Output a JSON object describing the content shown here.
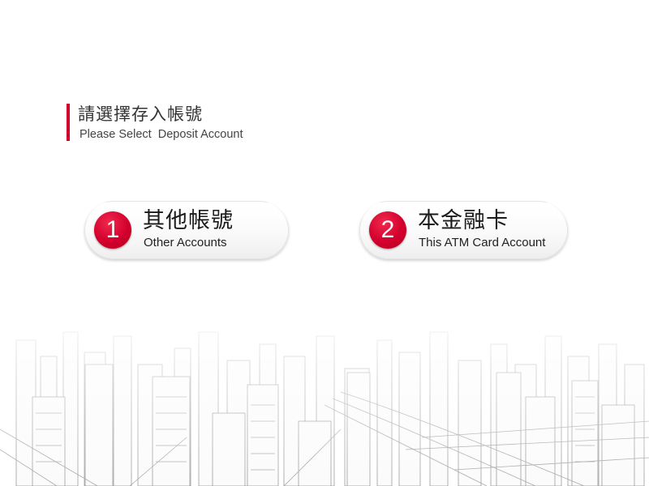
{
  "header": {
    "title": "請選擇存入帳號",
    "subtitle": "Please Select  Deposit Account"
  },
  "options": [
    {
      "number": "1",
      "title": "其他帳號",
      "subtitle": "Other Accounts"
    },
    {
      "number": "2",
      "title": "本金融卡",
      "subtitle": "This ATM Card Account"
    }
  ],
  "colors": {
    "accent": "#d3002d",
    "text": "#333333",
    "background": "#ffffff"
  },
  "decor": {
    "background_image": "city-skyline-sketch"
  }
}
